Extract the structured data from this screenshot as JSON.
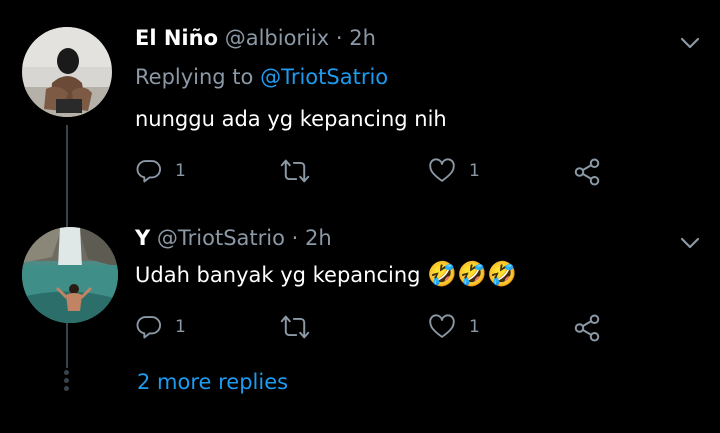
{
  "tweets": [
    {
      "display_name": "El Niño",
      "handle": "@albioriix",
      "separator": "·",
      "time": "2h",
      "replying_label": "Replying to",
      "replying_handle": "@TriotSatrio",
      "text": "nunggu ada yg kepancing nih",
      "reply_count": "1",
      "like_count": "1"
    },
    {
      "display_name": "Y",
      "handle": "@TriotSatrio",
      "separator": "·",
      "time": "2h",
      "text": "Udah banyak yg kepancing",
      "emoji": "🤣🤣🤣",
      "reply_count": "1",
      "like_count": "1"
    }
  ],
  "more_replies_label": "2 more replies",
  "colors": {
    "background": "#000000",
    "accent": "#1d9bf0",
    "muted": "#8b98a5",
    "thread_line": "#38444d"
  },
  "icons": [
    "chevron-down-icon",
    "reply-icon",
    "retweet-icon",
    "like-icon",
    "share-icon"
  ]
}
